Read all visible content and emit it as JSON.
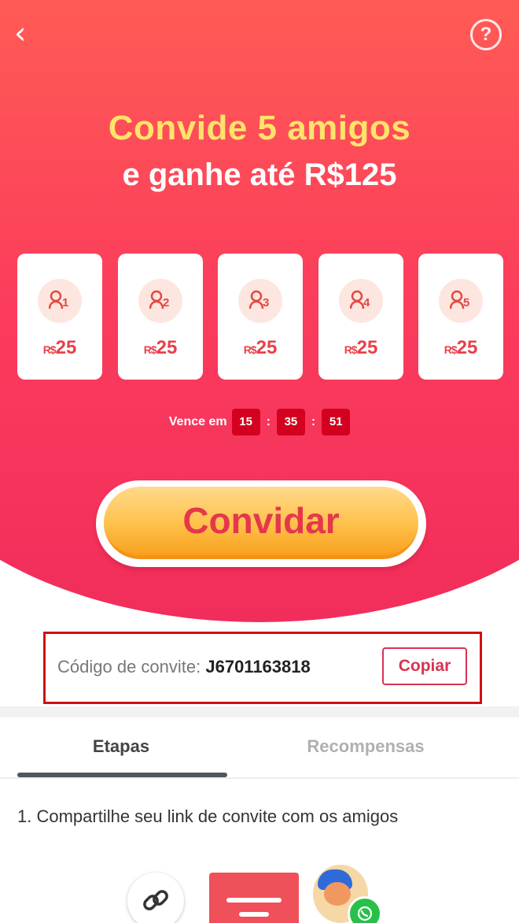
{
  "header": {
    "back_icon": "chevron-left-icon",
    "help_icon": "question-circle-icon",
    "back_glyph": "‹",
    "help_glyph": "?"
  },
  "hero": {
    "title": "Convide 5 amigos",
    "subtitle": "e ganhe até R$125",
    "colors": {
      "title": "#ffe36b",
      "gradient_top": "#ff7a52",
      "gradient_bottom": "#f12d5b"
    }
  },
  "rewards": [
    {
      "index": "1",
      "currency": "R$",
      "amount": "25",
      "icon": "friend-icon"
    },
    {
      "index": "2",
      "currency": "R$",
      "amount": "25",
      "icon": "friend-icon"
    },
    {
      "index": "3",
      "currency": "R$",
      "amount": "25",
      "icon": "friend-icon"
    },
    {
      "index": "4",
      "currency": "R$",
      "amount": "25",
      "icon": "friend-icon"
    },
    {
      "index": "5",
      "currency": "R$",
      "amount": "25",
      "icon": "friend-icon"
    }
  ],
  "timer": {
    "label": "Vence em",
    "hours": "15",
    "minutes": "35",
    "seconds": "51",
    "separator": ":"
  },
  "invite_button": {
    "label": "Convidar"
  },
  "invite_code": {
    "label": "Código de convite:",
    "value": "J6701163818",
    "copy_label": "Copiar"
  },
  "tabs": [
    {
      "label": "Etapas",
      "active": true
    },
    {
      "label": "Recompensas",
      "active": false
    }
  ],
  "steps": {
    "step1_text": "1. Compartilhe seu link de convite com os amigos",
    "icons": [
      "link-icon",
      "share-card-icon",
      "friend-avatar-icon",
      "whatsapp-icon"
    ]
  }
}
